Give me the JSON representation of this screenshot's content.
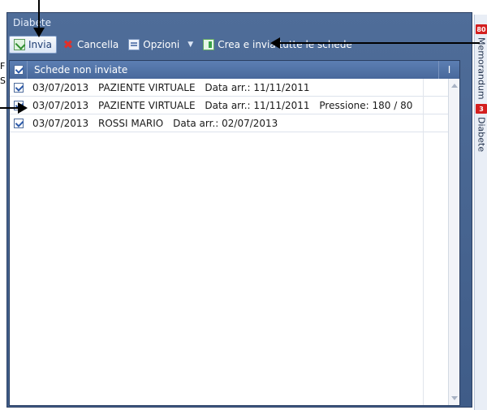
{
  "window": {
    "title": "Diabete"
  },
  "toolbar": {
    "send_label": "Invia",
    "cancel_label": "Cancella",
    "options_label": "Opzioni",
    "create_send_label": "Crea e invia tutte le schede"
  },
  "grid": {
    "header_title": "Schede non inviate",
    "header_i": "I",
    "rows": [
      {
        "date": "03/07/2013",
        "name": "PAZIENTE VIRTUALE",
        "arrival": "Data arr.: 11/11/2011",
        "extra": ""
      },
      {
        "date": "03/07/2013",
        "name": "PAZIENTE VIRTUALE",
        "arrival": "Data arr.: 11/11/2011",
        "extra": "Pressione: 180 / 80"
      },
      {
        "date": "03/07/2013",
        "name": "ROSSI MARIO",
        "arrival": "Data arr.: 02/07/2013",
        "extra": ""
      }
    ]
  },
  "side_tabs": {
    "memorandum": {
      "badge": "80",
      "label": "Memorandum"
    },
    "diabete": {
      "badge": "3",
      "label": "Diabete"
    }
  },
  "colors": {
    "badge": "#d31f1f",
    "frame": "#3f5c88",
    "header": "#5277ad"
  }
}
